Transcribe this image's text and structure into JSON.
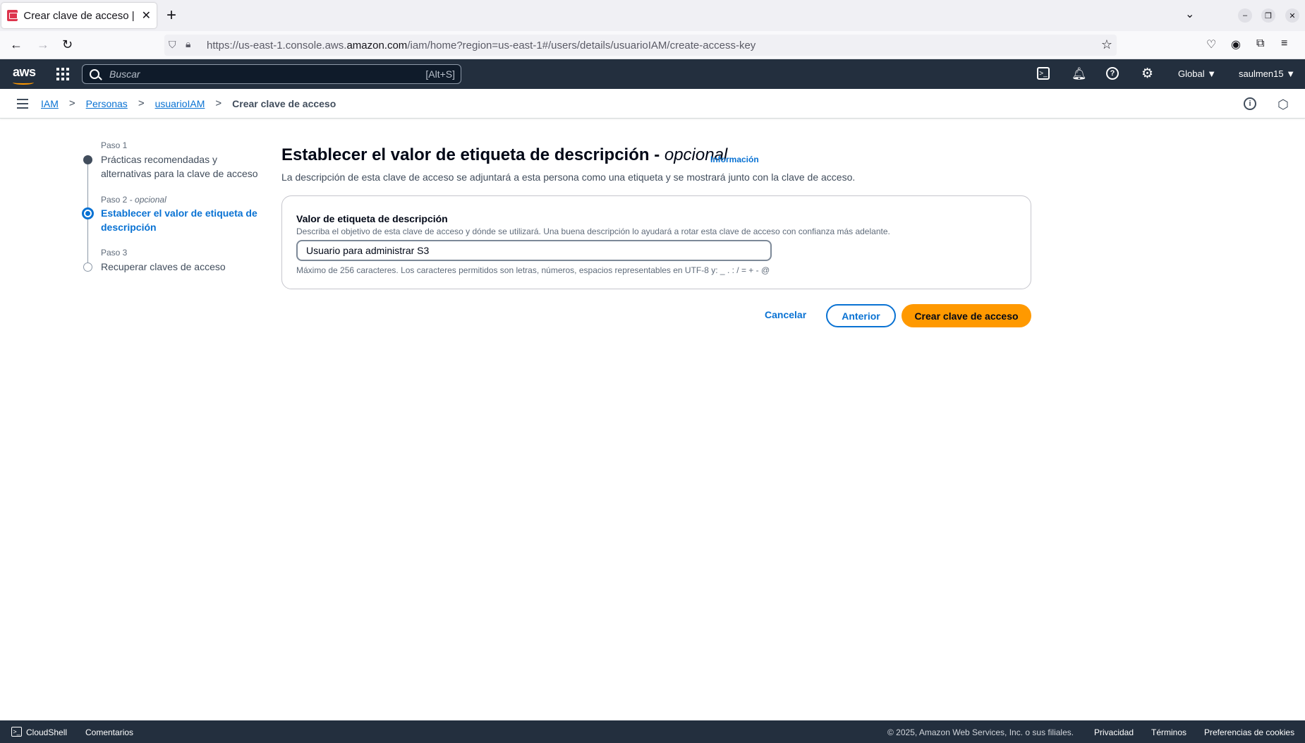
{
  "browser": {
    "tab_title": "Crear clave de acceso | IA",
    "tab_close": "✕",
    "new_tab": "+",
    "url_prefix": "https://us-east-1.console.aws.",
    "url_domain": "amazon.com",
    "url_suffix": "/iam/home?region=us-east-1#/users/details/usuarioIAM/create-access-key"
  },
  "aws_header": {
    "logo": "aws",
    "search_placeholder": "Buscar",
    "search_shortcut": "[Alt+S]",
    "region": "Global ▼",
    "account": "saulmen15 ▼"
  },
  "breadcrumb": {
    "items": [
      "IAM",
      "Personas",
      "usuarioIAM"
    ],
    "separator": ">",
    "current": "Crear clave de acceso"
  },
  "steps": [
    {
      "num": "Paso 1",
      "label": "Prácticas recomendadas y alternativas para la clave de acceso",
      "state": "done"
    },
    {
      "num": "Paso 2 - ",
      "num_optional": "opcional",
      "label": "Establecer el valor de etiqueta de descripción",
      "state": "current"
    },
    {
      "num": "Paso 3",
      "label": "Recuperar claves de acceso",
      "state": "pending"
    }
  ],
  "main": {
    "title": "Establecer el valor de etiqueta de descripción - ",
    "title_optional": "opcional",
    "info_link": "Información",
    "description": "La descripción de esta clave de acceso se adjuntará a esta persona como una etiqueta y se mostrará junto con la clave de acceso."
  },
  "form": {
    "label": "Valor de etiqueta de descripción",
    "description": "Describa el objetivo de esta clave de acceso y dónde se utilizará. Una buena descripción lo ayudará a rotar esta clave de acceso con confianza más adelante.",
    "value": "Usuario para administrar S3",
    "hint": "Máximo de 256 caracteres. Los caracteres permitidos son letras, números, espacios representables en UTF-8 y: _ . : / = + - @"
  },
  "actions": {
    "cancel": "Cancelar",
    "previous": "Anterior",
    "create": "Crear clave de acceso"
  },
  "footer": {
    "cloudshell": "CloudShell",
    "feedback": "Comentarios",
    "copyright": "© 2025, Amazon Web Services, Inc. o sus filiales.",
    "privacy": "Privacidad",
    "terms": "Términos",
    "cookies": "Preferencias de cookies"
  },
  "colors": {
    "aws_dark": "#232f3e",
    "link_blue": "#0972d3",
    "primary_orange": "#ff9900"
  }
}
